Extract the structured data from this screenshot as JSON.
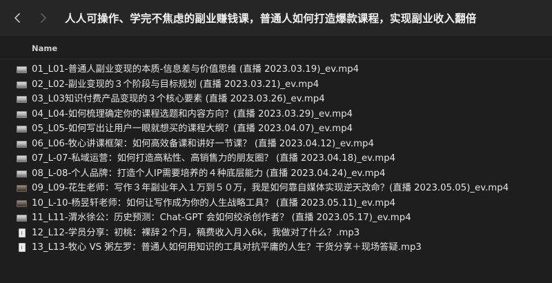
{
  "window": {
    "title": "人人可操作、学完不焦虑的副业赚钱课，普通人如何打造爆款课程，实现副业收入翻倍"
  },
  "toolbar": {
    "back_icon": "chevron-left-icon",
    "forward_icon": "chevron-right-icon"
  },
  "table": {
    "column_name": "Name"
  },
  "files": [
    {
      "name": "01_L01-普通人副业变现的本质-信息差与价值思维 (直播 2023.03.19)_ev.mp4",
      "kind": "video"
    },
    {
      "name": "02_L02-副业变现的３个阶段与目标规划 (直播 2023.03.21)_ev.mp4",
      "kind": "video"
    },
    {
      "name": "03_L03知识付费产品变现的３个核心要素 (直播 2023.03.26)_ev.mp4",
      "kind": "video"
    },
    {
      "name": "04_L04-如何梳理确定你的课程选题和内容方向？(直播 2023.03.29)_ev.mp4",
      "kind": "video"
    },
    {
      "name": "05_L05-如何写出让用户一眼就想买的课程大纲？(直播 2023.04.07)_ev.mp4",
      "kind": "video"
    },
    {
      "name": "06_L06-牧心讲课框架：如何高效备课和讲好一节课？ (直播 2023.04.12)_ev.mp4",
      "kind": "video"
    },
    {
      "name": "07_L-07-私域运营：如何打造高粘性、高销售力的朋友圈？ (直播 2023.04.18)_ev.mp4",
      "kind": "video"
    },
    {
      "name": "08_L-08-个人品牌：打造个人IP需要培养的４种底层能力 (直播 2023.04.24)_ev.mp4",
      "kind": "video"
    },
    {
      "name": "09_L09-花生老师：写作３年副业年入１万到５０万，我是如何靠自媒体实现逆天改命？(直播 2023.05.05)_ev.mp4",
      "kind": "video-dark"
    },
    {
      "name": "10_L-10-杨昱轩老师：如何让写作成为你的人生战略工具？ (直播 2023.05.11)_ev.mp4",
      "kind": "video-dark"
    },
    {
      "name": "11_L11-渭水徐公：历史预测：Chat-GPT 会如何绞杀创作者？ (直播 2023.05.17)_ev.mp4",
      "kind": "video"
    },
    {
      "name": "12_L12-学员分享：初桃：裸辞２个月，稿费收入月入6k，我做对了什么？.mp3",
      "kind": "audio"
    },
    {
      "name": "13_L13-牧心 VS 粥左罗：普通人如何用知识的工具对抗平庸的人生？干货分享＋现场答疑.mp3",
      "kind": "audio"
    }
  ]
}
